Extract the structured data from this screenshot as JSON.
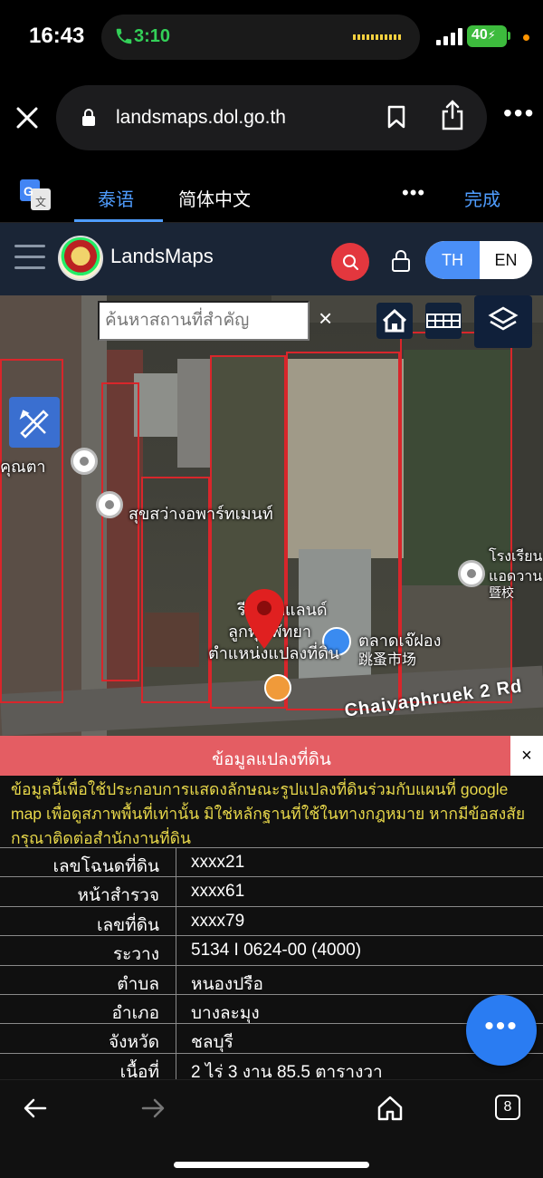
{
  "status_bar": {
    "time": "16:43",
    "call_time": "3:10",
    "battery": "40"
  },
  "browser": {
    "url": "landsmaps.dol.go.th",
    "icons": [
      "close-icon",
      "lock-icon",
      "bookmark-icon",
      "share-icon",
      "more-icon"
    ]
  },
  "translate_bar": {
    "tabs": [
      "泰语",
      "简体中文"
    ],
    "active_tab": "泰语",
    "more": "•••",
    "done": "完成"
  },
  "app_header": {
    "title": "LandsMaps",
    "lang_th": "TH",
    "lang_en": "EN",
    "accent": "#4a8ff7",
    "search_color": "#e3373e"
  },
  "map": {
    "search_placeholder": "ค้นหาสถานที่สำคัญ",
    "clear": "×",
    "road_label": "Chaiyaphruek 2 Rd",
    "poi": {
      "p1": "คุณตา",
      "p2": "สุขสว่างอพาร์ทเมนท์",
      "p3_line1": "โรงเรียน",
      "p3_line2": "แอดวาน",
      "p3_line3": "暨校",
      "market_line1": "ตลาดเจ๊ฝอง",
      "market_line2": "跳蚤市场",
      "parcel_line1": "รีสอร์ทแลนด์",
      "parcel_line2": "ลูกทุ่ง พัทยา",
      "parcel_line3": "ตำแหน่งแปลงที่ดิน"
    }
  },
  "info": {
    "title": "ข้อมูลแปลงที่ดิน",
    "close": "×",
    "disclaimer": "ข้อมูลนี้เพื่อใช้ประกอบการแสดงลักษณะรูปแปลงที่ดินร่วมกับแผนที่ google map เพื่อดูสภาพพื้นที่เท่านั้น มิใช่หลักฐานที่ใช้ในทางกฎหมาย หากมีข้อสงสัยกรุณาติดต่อสำนักงานที่ดิน",
    "rows": [
      {
        "k": "เลขโฉนดที่ดิน",
        "v": "xxxx21"
      },
      {
        "k": "หน้าสำรวจ",
        "v": "xxxx61"
      },
      {
        "k": "เลขที่ดิน",
        "v": "xxxx79"
      },
      {
        "k": "ระวาง",
        "v": "5134 I 0624-00 (4000)"
      },
      {
        "k": "ตำบล",
        "v": "หนองปรือ"
      },
      {
        "k": "อำเภอ",
        "v": "บางละมุง"
      },
      {
        "k": "จังหวัด",
        "v": "ชลบุรี"
      },
      {
        "k": "เนื้อที่",
        "v": "2 ไร่ 3 งาน 85.5 ตารางวา"
      }
    ],
    "fab": "•••"
  },
  "bottom_bar": {
    "tab_count": "8"
  }
}
